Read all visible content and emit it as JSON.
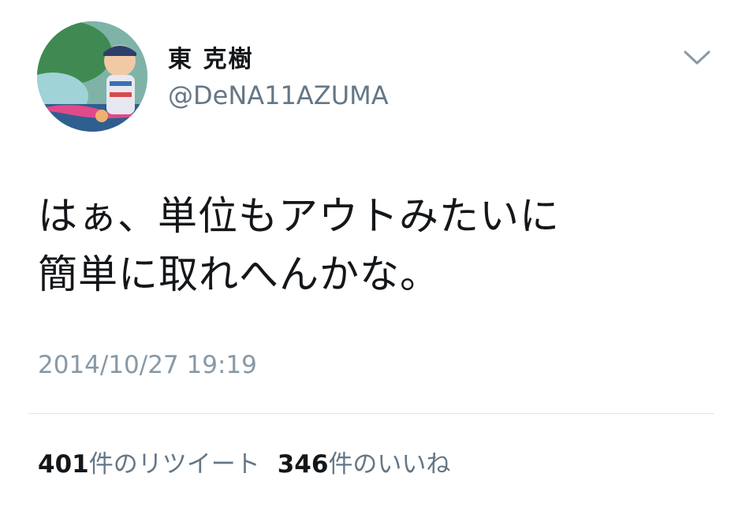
{
  "user": {
    "display_name": "東 克樹",
    "handle": "@DeNA11AZUMA"
  },
  "tweet": {
    "lines": [
      "はぁ、単位もアウトみたいに",
      "簡単に取れへんかな。"
    ],
    "timestamp": "2014/10/27 19:19"
  },
  "stats": {
    "retweets_count": "401",
    "retweets_label": "件のリツイート",
    "likes_count": "346",
    "likes_label": "件のいいね"
  },
  "icons": {
    "menu": "chevron-down-icon"
  },
  "colors": {
    "text": "#14171a",
    "secondary": "#657786",
    "timestamp": "#8899a6",
    "divider": "#dfe3e6"
  }
}
